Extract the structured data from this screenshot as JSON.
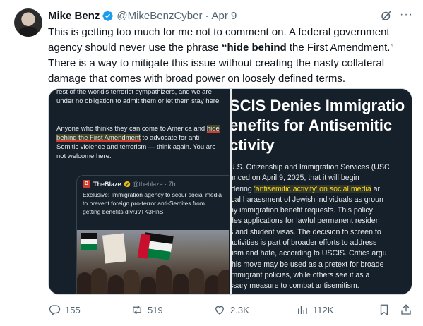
{
  "tweet": {
    "author_name": "Mike Benz",
    "handle": "@MikeBenzCyber",
    "separator": "·",
    "date": "Apr 9",
    "more_label": "···",
    "text_part1": "This is getting too much for me not to comment on. A federal government agency should never use the phrase ",
    "text_bold": "“hide behind",
    "text_part2": " the First Amendment.” There is a way to mitigate this issue without creating the nasty collateral damage that comes with broad power on loosely defined terms."
  },
  "media": {
    "left": {
      "top_text": "rest of the world's terrorist sympathizers, and we are under no obligation to admit them or let them stay here.",
      "para_pre": "Anyone who thinks they can come to America and ",
      "para_highlight": "hide behind the First Amendment",
      "para_post": " to advocate for anti-Semitic violence and terrorism — think again. You are not welcome here.",
      "quote": {
        "name": "TheBlaze",
        "handle": "@theblaze · 7h",
        "text": "Exclusive: Immigration agency to scour social media to prevent foreign pro-terror anti-Semites from getting benefits dlvr.it/TK3HnS"
      }
    },
    "right": {
      "title_lines": [
        "SCIS Denies Immigratio",
        "enefits for Antisemitic",
        "ctivity"
      ],
      "body_line1": "U.S. Citizenship and Immigration Services (USC",
      "body_line2": "unced on April 9, 2025, that it will begin",
      "body_line3_pre": "idering ",
      "body_line3_hl": "'antisemitic activity' on social media",
      "body_line3_post": " ar",
      "body_lines_rest": [
        "ical harassment of Jewish individuals as groun",
        "ny immigration benefit requests. This policy",
        "des applications for lawful permanent residen",
        "s and student visas. The decision to screen fo",
        "activities is part of broader efforts to address",
        "rism and hate, according to USCIS. Critics argu",
        "this move may be used as a pretext for broade",
        "immigrant policies, while others see it as a",
        "ssary measure to combat antisemitism."
      ]
    }
  },
  "actions": {
    "replies": "155",
    "reposts": "519",
    "likes": "2.3K",
    "views": "112K"
  },
  "colors": {
    "accent": "#1d9bf0",
    "muted": "#536471",
    "text": "#0f1419",
    "highlight_yellow": "#f9d71c"
  },
  "icons": [
    "verified-badge-icon",
    "grok-icon",
    "more-icon",
    "reply-icon",
    "repost-icon",
    "like-icon",
    "views-icon",
    "bookmark-icon",
    "share-icon"
  ]
}
